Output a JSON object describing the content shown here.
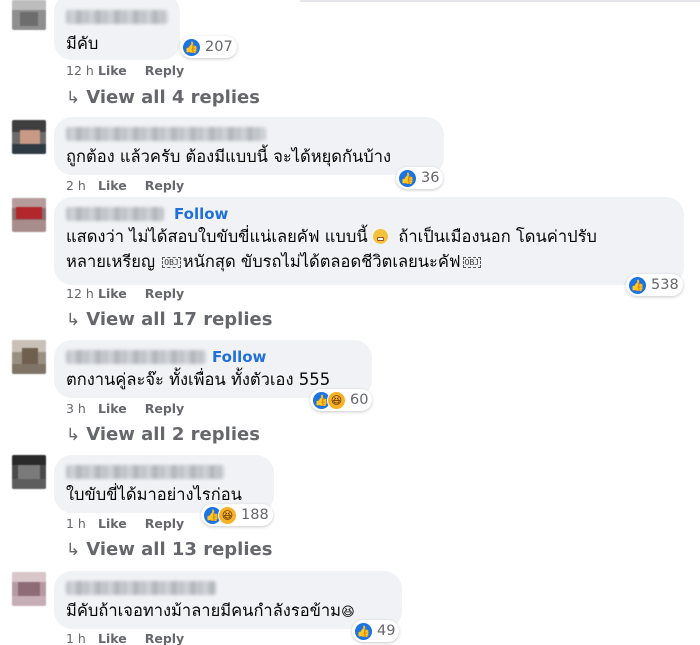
{
  "comments": [
    {
      "text": "มีคับ",
      "reaction_count": "207",
      "reactions": [
        "like-icon"
      ],
      "time": "12 h",
      "like_label": "Like",
      "reply_label": "Reply",
      "view_replies": "View all 4 replies",
      "follow": ""
    },
    {
      "text": "ถูกต้อง แล้วครับ ต้องมีแบบนี้ จะได้หยุดกันบ้าง",
      "reaction_count": "36",
      "reactions": [
        "like-icon"
      ],
      "time": "2 h",
      "like_label": "Like",
      "reply_label": "Reply",
      "view_replies": "",
      "follow": ""
    },
    {
      "text_line1": "แสดงว่า ไม่ได้สอบใบขับขี่แน่เลยคัฟ แบบนี้",
      "text_line1b": "ถ้าเป็นเมืองนอก โดนค่าปรับ",
      "text_line2a": "หลายเหรียญ",
      "text_line2b": "หนักสุด ขับรถไม่ได้ตลอดชีวิตเลยนะคัฟ",
      "obj_label": "OBJ",
      "reaction_count": "538",
      "reactions": [
        "like-icon"
      ],
      "time": "12 h",
      "like_label": "Like",
      "reply_label": "Reply",
      "view_replies": "View all 17 replies",
      "follow": "Follow"
    },
    {
      "text": "ตกงานคู่ละจ๊ะ ทั้งเพื่อน ทั้งตัวเอง 555",
      "reaction_count": "60",
      "reactions": [
        "like-icon",
        "haha-icon"
      ],
      "time": "3 h",
      "like_label": "Like",
      "reply_label": "Reply",
      "view_replies": "View all 2 replies",
      "follow": "Follow"
    },
    {
      "text": "ใบขับขี่ได้มาอย่างไรก่อน",
      "reaction_count": "188",
      "reactions": [
        "like-icon",
        "haha-icon"
      ],
      "time": "1 h",
      "like_label": "Like",
      "reply_label": "Reply",
      "view_replies": "View all 13 replies",
      "follow": ""
    },
    {
      "text": "มีคับถ้าเจอทางม้าลายมีคนกำลังรอข้าม",
      "reaction_count": "49",
      "reactions": [
        "like-icon"
      ],
      "time": "1 h",
      "like_label": "Like",
      "reply_label": "Reply",
      "view_replies": "",
      "follow": ""
    }
  ],
  "icons": {
    "like": "👍",
    "haha": "😆",
    "reply_arrow": "↳"
  },
  "colors": {
    "bubble": "#f0f2f5",
    "link_blue": "#216fdb",
    "like_blue": "#1b74e4",
    "muted": "#65676b"
  }
}
